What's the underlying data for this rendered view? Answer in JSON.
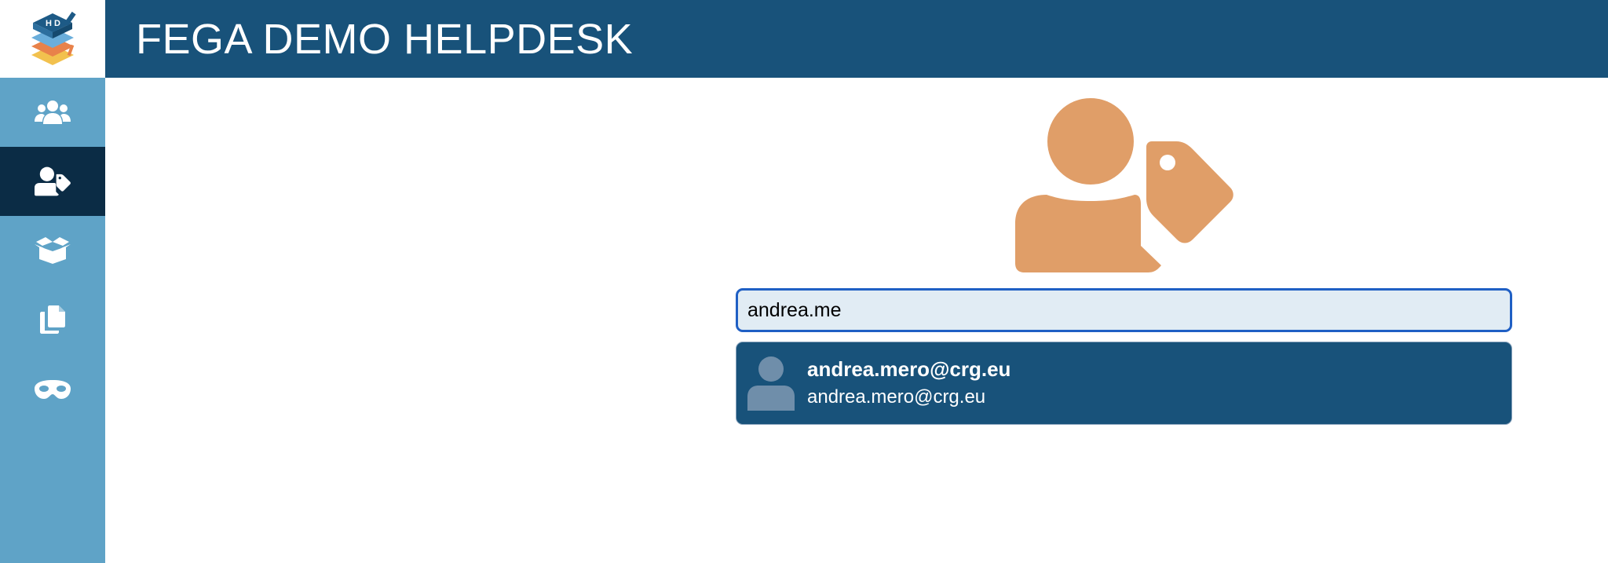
{
  "header": {
    "logo_icon": "helpdesk-logo-icon",
    "title": "FEGA DEMO HELPDESK",
    "background": "#18527a"
  },
  "sidebar": {
    "background": "#5fa3c7",
    "active_background": "#0b2c45",
    "items": [
      {
        "icon": "users-icon",
        "active": false
      },
      {
        "icon": "user-tag-icon",
        "active": true
      },
      {
        "icon": "box-open-icon",
        "active": false
      },
      {
        "icon": "copy-icon",
        "active": false
      },
      {
        "icon": "mask-icon",
        "active": false
      }
    ]
  },
  "main": {
    "hero_icon": "user-tag-icon",
    "hero_color": "#e09e68",
    "search": {
      "value": "andrea.me",
      "placeholder": ""
    },
    "suggestions": [
      {
        "icon": "user-icon",
        "primary": "andrea.mero@crg.eu",
        "secondary": "andrea.mero@crg.eu"
      }
    ]
  }
}
